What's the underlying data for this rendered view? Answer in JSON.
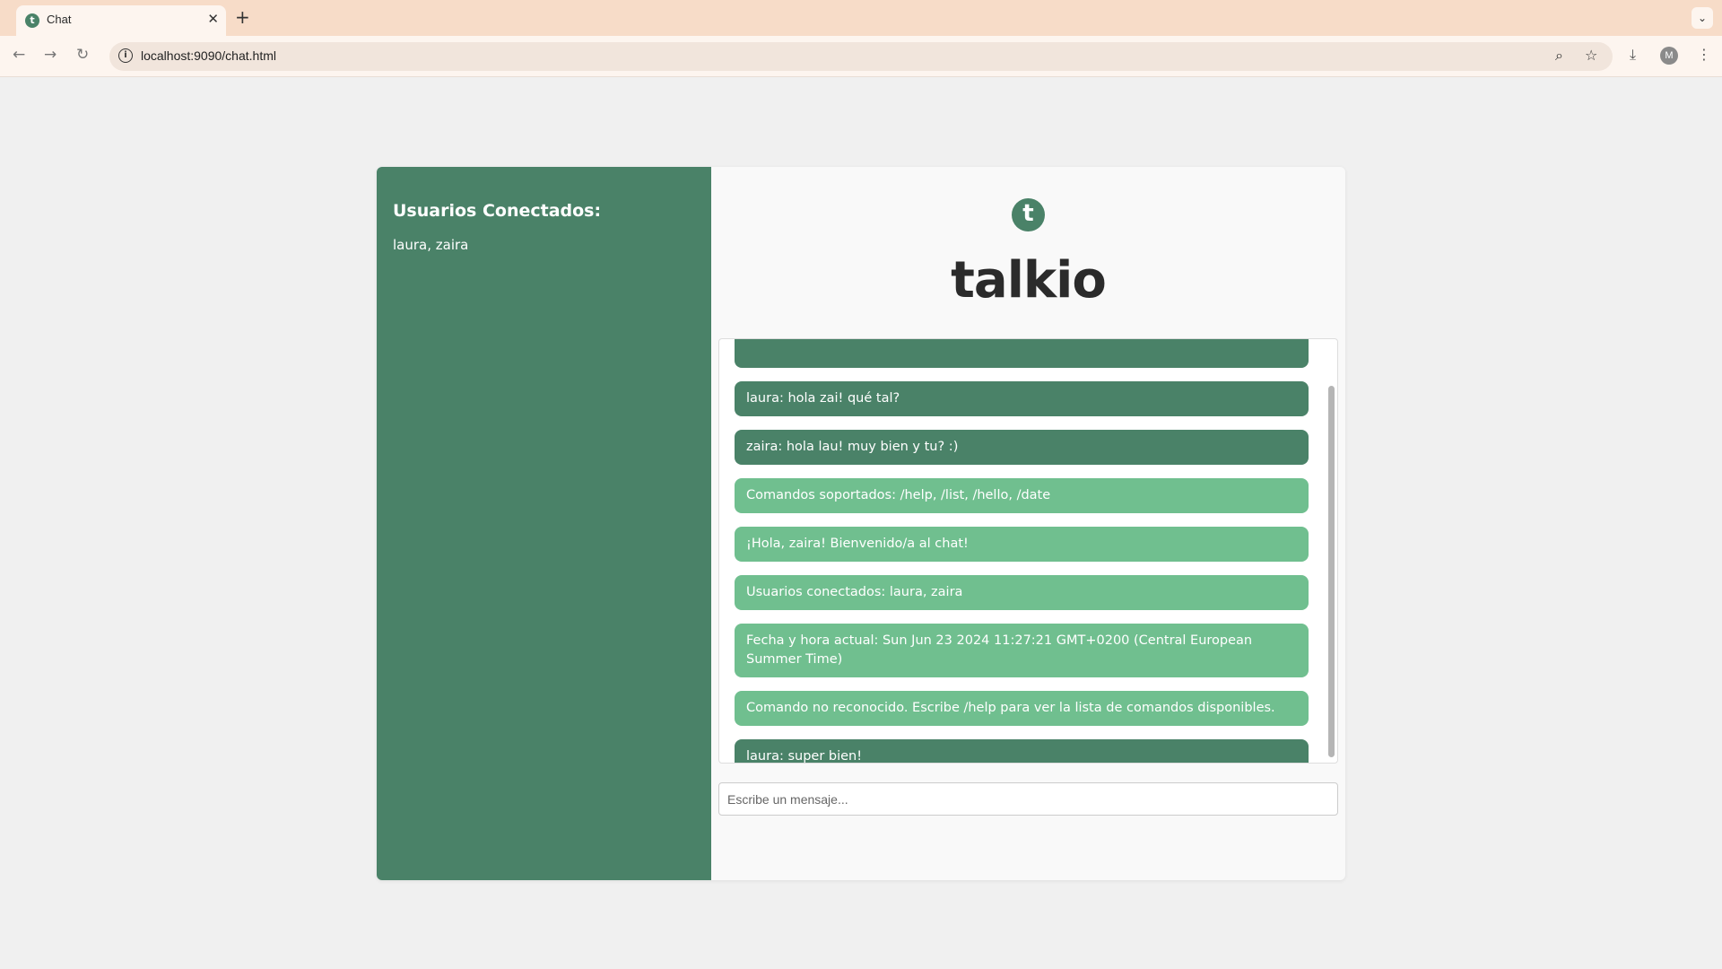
{
  "browser": {
    "tab_title": "Chat",
    "tab_close": "✕",
    "new_tab": "+",
    "tab_menu": "⌄",
    "url": "localhost:9090/chat.html",
    "site_info": "i",
    "avatar_letter": "M",
    "icons": [
      "back-arrow-icon",
      "forward-arrow-icon",
      "reload-icon",
      "zoom-icon",
      "bookmark-star-icon",
      "download-icon",
      "more-menu-icon"
    ]
  },
  "sidebar": {
    "title": "Usuarios Conectados:",
    "users": "laura, zaira"
  },
  "app": {
    "logo_letter": "t",
    "brand_name": "talkio"
  },
  "messages": [
    {
      "type": "user",
      "text": ""
    },
    {
      "type": "user",
      "text": "laura: hola zai! qué tal?"
    },
    {
      "type": "user",
      "text": "zaira: hola lau! muy bien y tu? :)"
    },
    {
      "type": "system",
      "text": "Comandos soportados: /help, /list, /hello, /date"
    },
    {
      "type": "system",
      "text": "¡Hola, zaira! Bienvenido/a al chat!"
    },
    {
      "type": "system",
      "text": "Usuarios conectados: laura, zaira"
    },
    {
      "type": "system",
      "text": "Fecha y hora actual: Sun Jun 23 2024 11:27:21 GMT+0200 (Central European Summer Time)"
    },
    {
      "type": "system",
      "text": "Comando no reconocido. Escribe /help para ver la lista de comandos disponibles."
    },
    {
      "type": "user",
      "text": "laura: super bien!"
    }
  ],
  "input": {
    "placeholder": "Escribe un mensaje...",
    "value": ""
  },
  "colors": {
    "sidebar": "#4a8268",
    "user_message": "#4a8268",
    "system_message": "#70bf8f",
    "tab_strip": "#f7dcc8"
  }
}
